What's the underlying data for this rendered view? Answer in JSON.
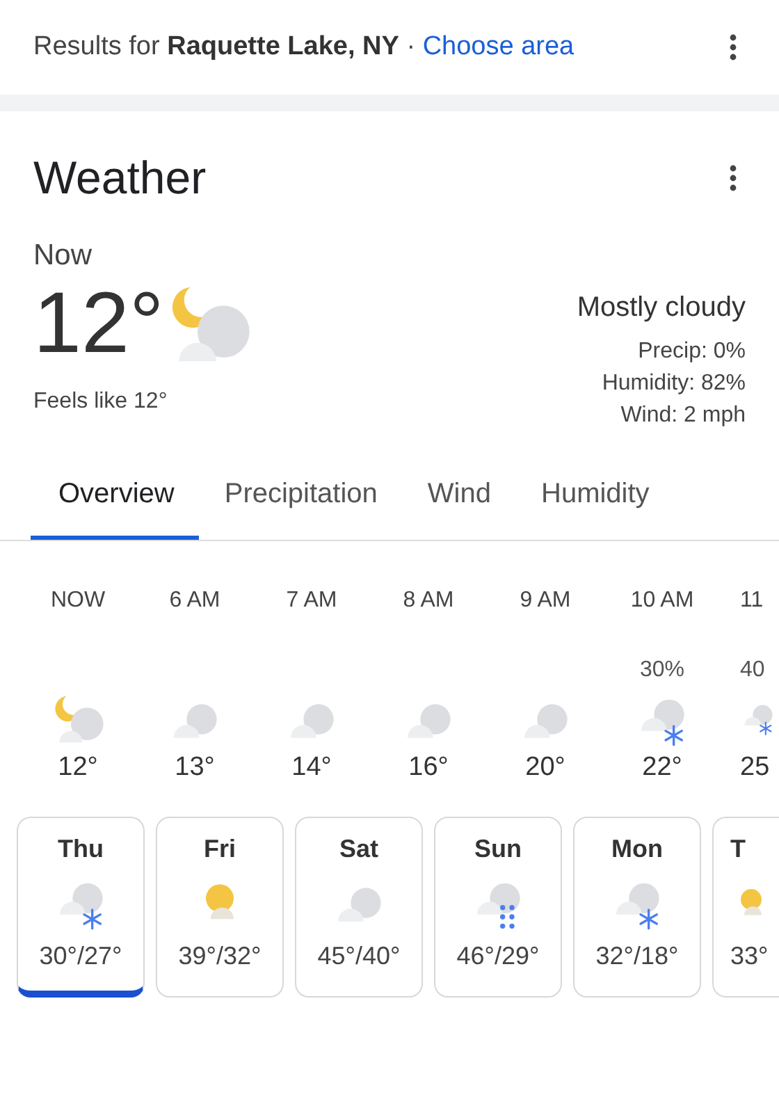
{
  "header": {
    "prefix": "Results for",
    "location": "Raquette Lake, NY",
    "separator": "·",
    "link": "Choose area"
  },
  "card": {
    "title": "Weather"
  },
  "now": {
    "label": "Now",
    "temp": "12°",
    "kind": "moon-cloud",
    "feels_like": "Feels like 12°",
    "condition": "Mostly cloudy",
    "details": [
      "Precip: 0%",
      "Humidity: 82%",
      "Wind: 2 mph"
    ]
  },
  "tabs": [
    {
      "label": "Overview",
      "selected": true
    },
    {
      "label": "Precipitation",
      "selected": false
    },
    {
      "label": "Wind",
      "selected": false
    },
    {
      "label": "Humidity",
      "selected": false
    }
  ],
  "hourly": [
    {
      "time": "NOW",
      "kind": "moon-cloud",
      "temp": "12°"
    },
    {
      "time": "6 AM",
      "kind": "cloud",
      "temp": "13°"
    },
    {
      "time": "7 AM",
      "kind": "cloud",
      "temp": "14°"
    },
    {
      "time": "8 AM",
      "kind": "cloud",
      "temp": "16°"
    },
    {
      "time": "9 AM",
      "kind": "cloud",
      "temp": "20°"
    },
    {
      "time": "10 AM",
      "precip": "30%",
      "kind": "snow",
      "temp": "22°"
    },
    {
      "time": "11",
      "precip": "40",
      "kind": "snow",
      "temp": "25"
    }
  ],
  "daily": [
    {
      "day": "Thu",
      "kind": "snow",
      "temps": "30°/27°",
      "selected": true
    },
    {
      "day": "Fri",
      "kind": "sun-cloud",
      "temps": "39°/32°",
      "selected": false
    },
    {
      "day": "Sat",
      "kind": "cloud",
      "temps": "45°/40°",
      "selected": false
    },
    {
      "day": "Sun",
      "kind": "rain",
      "temps": "46°/29°",
      "selected": false
    },
    {
      "day": "Mon",
      "kind": "snow",
      "temps": "32°/18°",
      "selected": false
    },
    {
      "day": "T",
      "kind": "sun-cloud",
      "temps": "33°",
      "selected": false
    }
  ]
}
